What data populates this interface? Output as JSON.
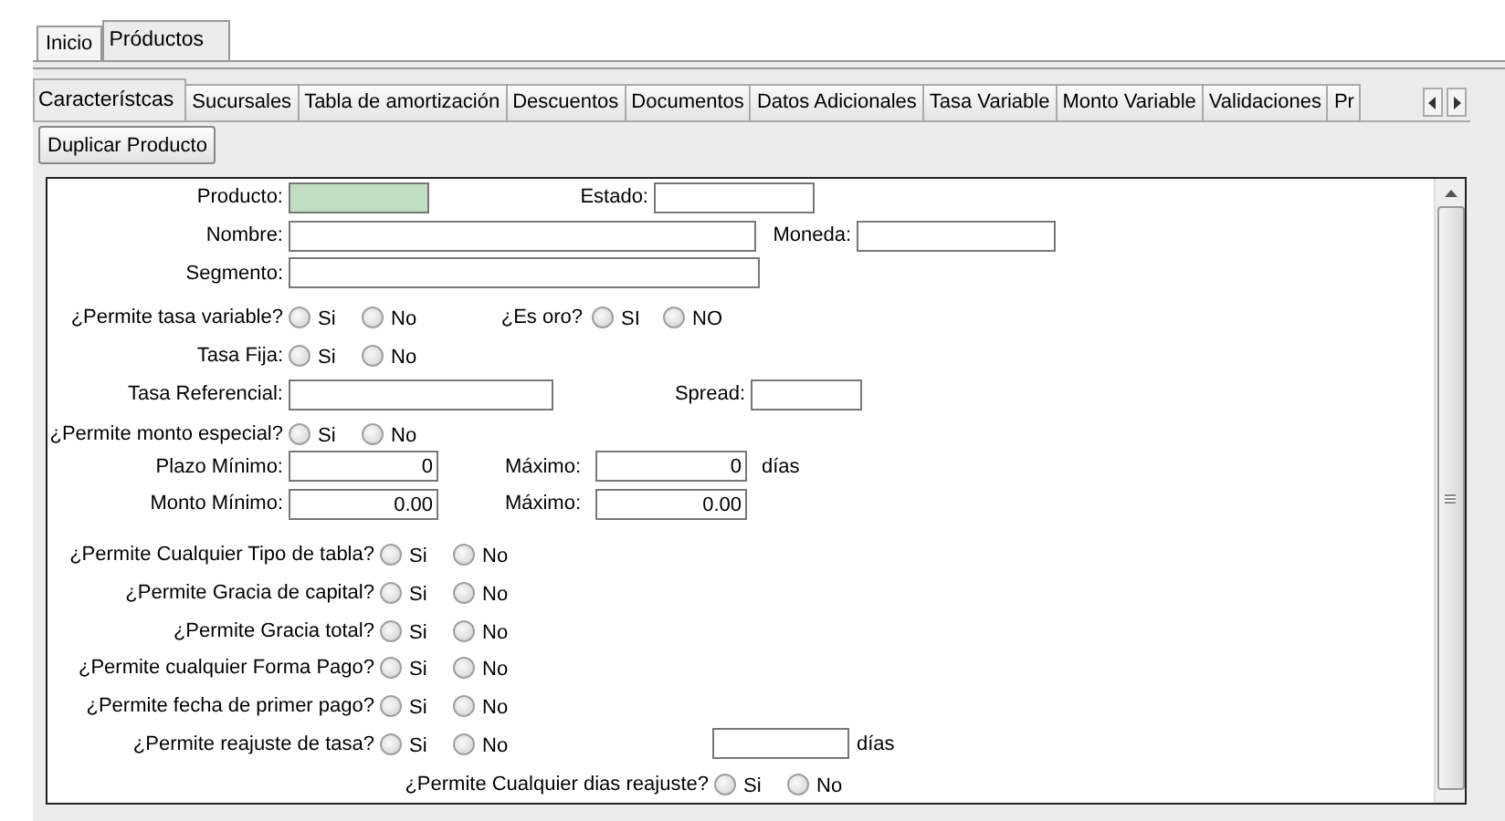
{
  "top_tabs": [
    {
      "label": "Inicio",
      "selected": false
    },
    {
      "label": "Próductos",
      "selected": true
    }
  ],
  "tabs": [
    {
      "label": "Característcas",
      "selected": true
    },
    {
      "label": "Sucursales",
      "selected": false
    },
    {
      "label": "Tabla de amortización",
      "selected": false
    },
    {
      "label": "Descuentos",
      "selected": false
    },
    {
      "label": "Documentos",
      "selected": false
    },
    {
      "label": "Datos Adicionales",
      "selected": false
    },
    {
      "label": "Tasa Variable",
      "selected": false
    },
    {
      "label": "Monto Variable",
      "selected": false
    },
    {
      "label": "Validaciones",
      "selected": false
    },
    {
      "label": "Pr",
      "selected": false
    }
  ],
  "toolbar": {
    "button": "Duplicar Producto"
  },
  "form": {
    "rows": [
      {
        "items": [
          {
            "kind": "field",
            "label": "Producto:",
            "highlighted": true
          },
          {
            "kind": "field",
            "label": "Estado:",
            "highlighted": false
          }
        ]
      },
      {
        "items": [
          {
            "kind": "field",
            "label": "Nombre:",
            "highlighted": false
          },
          {
            "kind": "field",
            "label": "Moneda:",
            "highlighted": false
          }
        ]
      },
      {
        "items": [
          {
            "kind": "field",
            "label": "Segmento:",
            "highlighted": false
          }
        ]
      },
      {
        "items": [
          {
            "kind": "radio",
            "label": "¿Permite tasa variable?",
            "options": [
              {
                "label": "Si",
                "selected": false
              },
              {
                "label": "No",
                "selected": false
              }
            ]
          },
          {
            "kind": "radio",
            "label": "¿Es oro?",
            "options": [
              {
                "label": "SI",
                "selected": false
              },
              {
                "label": "NO",
                "selected": false
              }
            ]
          }
        ]
      },
      {
        "items": [
          {
            "kind": "radio",
            "label": "Tasa Fija:",
            "options": [
              {
                "label": "Si",
                "selected": false
              },
              {
                "label": "No",
                "selected": false
              }
            ]
          }
        ]
      },
      {
        "items": [
          {
            "kind": "field",
            "label": "Tasa Referencial:",
            "highlighted": false
          },
          {
            "kind": "field",
            "label": "Spread:",
            "highlighted": false
          }
        ]
      },
      {
        "items": [
          {
            "kind": "radio",
            "label": "¿Permite monto especial?",
            "options": [
              {
                "label": "Si",
                "selected": false
              },
              {
                "label": "No",
                "selected": false
              }
            ]
          }
        ]
      },
      {
        "items": [
          {
            "kind": "number",
            "label": "Plazo Mínimo:",
            "value": "0",
            "highlighted": false
          },
          {
            "kind": "number",
            "label": "Máximo:",
            "value": "0",
            "unit": "días",
            "highlighted": false
          }
        ]
      },
      {
        "items": [
          {
            "kind": "number",
            "label": "Monto Mínimo:",
            "value": "0.00",
            "highlighted": false
          },
          {
            "kind": "number",
            "label": "Máximo:",
            "value": "0.00",
            "highlighted": false
          }
        ]
      },
      {
        "items": [
          {
            "kind": "radio",
            "label": "¿Permite Cualquier Tipo de tabla?",
            "options": [
              {
                "label": "Si",
                "selected": false
              },
              {
                "label": "No",
                "selected": false
              }
            ]
          }
        ]
      },
      {
        "items": [
          {
            "kind": "radio",
            "label": "¿Permite Gracia de capital?",
            "options": [
              {
                "label": "Si",
                "selected": false
              },
              {
                "label": "No",
                "selected": false
              }
            ]
          }
        ]
      },
      {
        "items": [
          {
            "kind": "radio",
            "label": "¿Permite Gracia total?",
            "options": [
              {
                "label": "Si",
                "selected": false
              },
              {
                "label": "No",
                "selected": false
              }
            ]
          }
        ]
      },
      {
        "items": [
          {
            "kind": "radio",
            "label": "¿Permite cualquier Forma Pago?",
            "options": [
              {
                "label": "Si",
                "selected": false
              },
              {
                "label": "No",
                "selected": false
              }
            ]
          }
        ]
      },
      {
        "items": [
          {
            "kind": "radio",
            "label": "¿Permite fecha de primer pago?",
            "options": [
              {
                "label": "Si",
                "selected": false
              },
              {
                "label": "No",
                "selected": false
              }
            ]
          }
        ]
      },
      {
        "items": [
          {
            "kind": "radio",
            "label": "¿Permite reajuste de tasa?",
            "options": [
              {
                "label": "Si",
                "selected": false
              },
              {
                "label": "No",
                "selected": false
              }
            ]
          },
          {
            "kind": "field",
            "unit": "días",
            "highlighted": false
          }
        ]
      },
      {
        "items": [
          {
            "kind": "radio",
            "label": "¿Permite Cualquier dias reajuste?",
            "options": [
              {
                "label": "Si",
                "selected": false
              },
              {
                "label": "No",
                "selected": false
              }
            ]
          }
        ]
      }
    ]
  }
}
